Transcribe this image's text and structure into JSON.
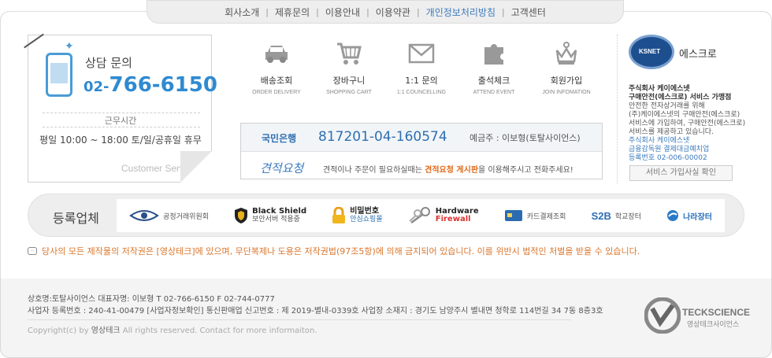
{
  "topnav": {
    "items": [
      {
        "label": "회사소개"
      },
      {
        "label": "제휴문의"
      },
      {
        "label": "이용안내"
      },
      {
        "label": "이용약관"
      },
      {
        "label": "개인정보처리방침"
      },
      {
        "label": "고객센터"
      }
    ],
    "active_color": "#3a7bbd"
  },
  "contact": {
    "label": "상담 문의",
    "number_prefix": "02-",
    "number_main": "766-6150",
    "hours_title": "근무시간",
    "hours": "평일 10:00 ~ 18:00  토/일/공휴일 휴무",
    "footer_label": "Customer Service",
    "accent_color": "#2f8ad1"
  },
  "menus": [
    {
      "ko": "배송조회",
      "en": "ORDER DELIVERY",
      "icon": "car-icon"
    },
    {
      "ko": "장바구니",
      "en": "SHOPPING CART",
      "icon": "cart-icon"
    },
    {
      "ko": "1:1 문의",
      "en": "1:1 COUNCELLING",
      "icon": "mail-icon"
    },
    {
      "ko": "출석체크",
      "en": "ATTEND EVENT",
      "icon": "puzzle-icon"
    },
    {
      "ko": "회원가입",
      "en": "JOIN INFOMATION",
      "icon": "crown-icon"
    }
  ],
  "bank": {
    "name": "국민은행",
    "account": "817201-04-160574",
    "holder": "예금주 : 이보형(토탈사이언스)",
    "quote_title": "견적요청",
    "quote_text_before": "견적이나 주문이 필요하실때는 ",
    "quote_text_highlight": "견적요청 게시판",
    "quote_text_after": "을 이용해주시고 전화주세요!"
  },
  "escrow": {
    "seal_label": "KSNET",
    "title": "에스크로",
    "line1": "주식회사 케이에스넷",
    "line2": "구매안전(에스크로) 서비스 가맹점",
    "desc1": "안전한 전자상거래를 위해",
    "desc2": "(주)케이에스넷의 구매안전(에스크로)",
    "desc3": "서비스에 가입하여, 구매안전(에스크로)",
    "desc4": "서비스를 제공하고 있습니다.",
    "blue1": "주식회사 케이에스넷",
    "blue2": "금융감독원 결제대금예치업",
    "blue3": "등록번호 02-006-00002",
    "button": "서비스 가입사실 확인"
  },
  "partners": {
    "title": "등록업체",
    "items": [
      {
        "name": "공정거래위원회",
        "icon": "ftc-eye-icon"
      },
      {
        "name_top": "Black Shield",
        "name_bottom": "보안서버 적용중",
        "icon": "shield-icon"
      },
      {
        "name_top": "비밀번호",
        "name_bottom": "안심쇼핑몰",
        "icon": "lock-icon"
      },
      {
        "name_top": "Hardware",
        "name_bottom": "Firewall",
        "icon": "keys-icon"
      },
      {
        "name": "카드결제조회",
        "icon": "card-icon"
      },
      {
        "name_top": "S2B",
        "name_bottom": "학교장터",
        "icon": "s2b-icon"
      },
      {
        "name": "나라장터",
        "icon": "nara-icon"
      }
    ]
  },
  "notice": {
    "text": "당사의 모든 제작물의 저작권은 [영상테크]에 있으며, 무단복제나 도용은 저작권법(97조5항)에 의해 금지되어 있습니다. 이를 위반시 법적인 처벌을 받을 수 있습니다.",
    "color": "#d9762b"
  },
  "footer": {
    "line1": "상호명:토탈사이언스    대표자명: 이보형    T 02-766-6150   F 02-744-0777",
    "line2": "사업자 등록번호 : 240-41-00479 [사업자정보확인]     통신판매업 신고번호 : 제 2019-별내-0339호      사업장 소재지 : 경기도 남양주시 별내면 청학로 114번길 34 7동 8층3호",
    "copy_before": "Copyright(c)  by ",
    "copy_brand": "영상테크",
    "copy_after": " All rights reserved. Contact for more informaiton."
  },
  "brand": {
    "en": "TECKSCIENCE",
    "ko": "영상테크사이언스"
  }
}
